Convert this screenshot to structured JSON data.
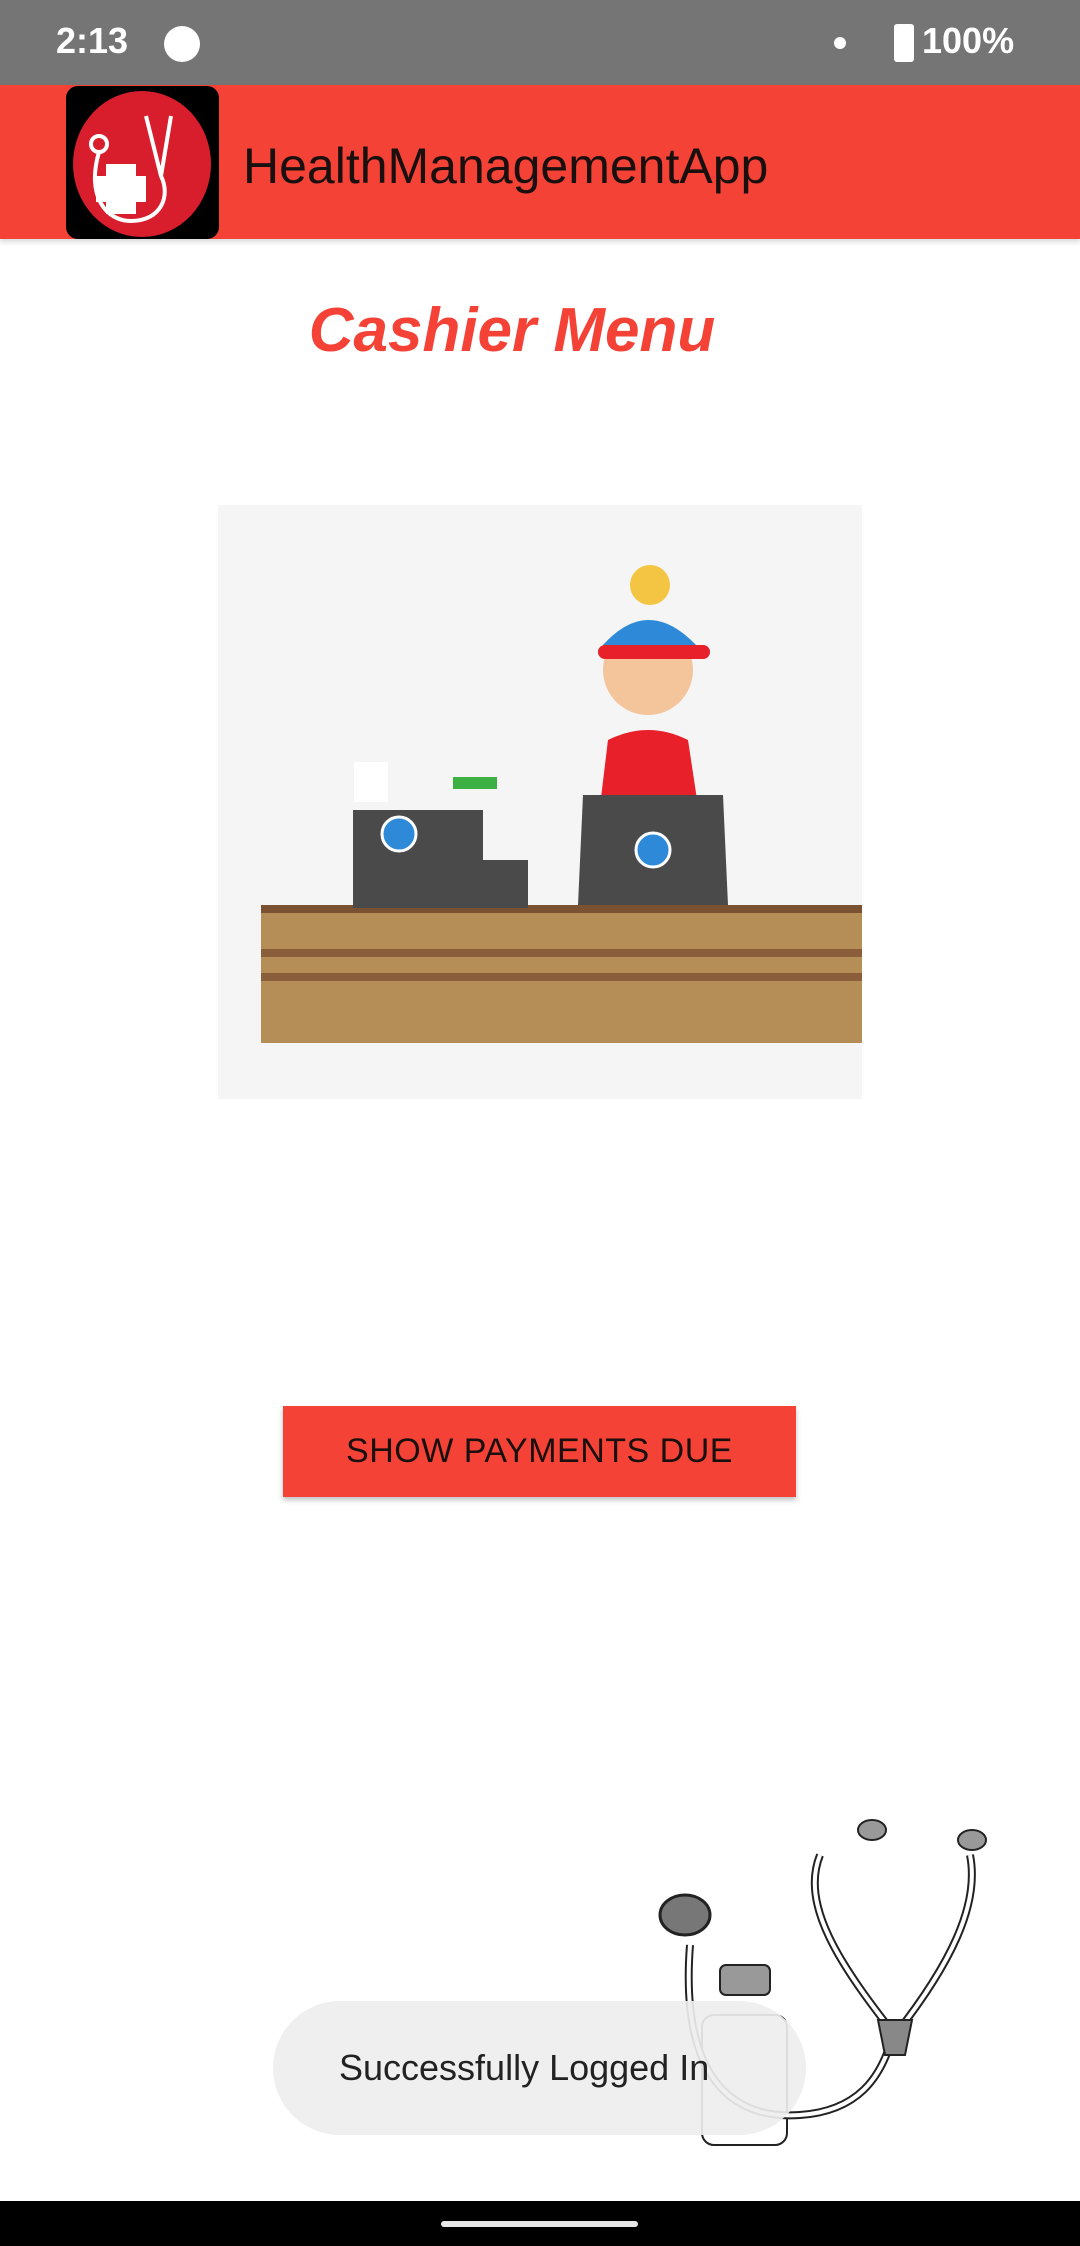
{
  "status_bar": {
    "time": "2:13",
    "battery": "100%"
  },
  "app_bar": {
    "title": "HealthManagementApp"
  },
  "main": {
    "heading": "Cashier Menu",
    "button_label": "SHOW PAYMENTS DUE"
  },
  "toast": {
    "message": "Successfully Logged In"
  },
  "colors": {
    "primary": "#f44336",
    "status_bar": "#757575"
  }
}
